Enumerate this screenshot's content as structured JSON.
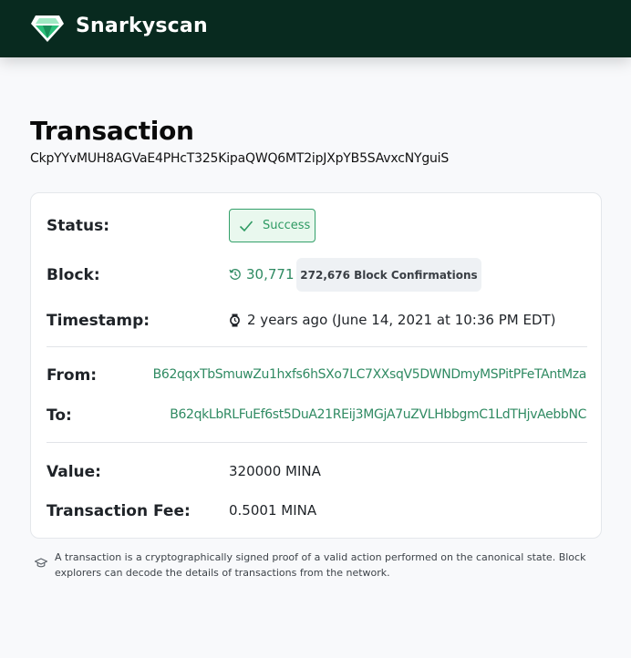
{
  "header": {
    "brand": "Snarkyscan",
    "logo_icon": "emerald-gem-icon",
    "background": "#082a1f"
  },
  "page": {
    "title": "Transaction",
    "hash": "CkpYYvMUH8AGVaE4PHcT325KipaQWQ6MT2ipJXpYB5SAvxcNYguiS"
  },
  "details": {
    "status": {
      "label": "Status:",
      "value": "Success",
      "icon": "checkmark-icon",
      "color": "#2e9a63"
    },
    "block": {
      "label": "Block:",
      "value": "30,771",
      "icon": "history-clock-icon",
      "confirmations": "272,676 Block Confirmations"
    },
    "timestamp": {
      "label": "Timestamp:",
      "value": "2 years ago (June 14, 2021 at 10:36 PM EDT)",
      "icon": "watch-icon"
    },
    "from": {
      "label": "From:",
      "value": "B62qqxTbSmuwZu1hxfs6hSXo7LC7XXsqV5DWNDmyMSPitPFeTAntMza"
    },
    "to": {
      "label": "To:",
      "value": "B62qkLbRLFuEf6st5DuA21REij3MGjA7uZVLHbbgmC1LdTHjvAebbNC"
    },
    "value": {
      "label": "Value:",
      "value": "320000 MINA"
    },
    "fee": {
      "label": "Transaction Fee:",
      "value": "0.5001 MINA"
    }
  },
  "footnote": {
    "icon": "graduation-cap-icon",
    "text": "A transaction is a cryptographically signed proof of a valid action performed on the canonical state. Block explorers can decode the details of transactions from the network."
  }
}
